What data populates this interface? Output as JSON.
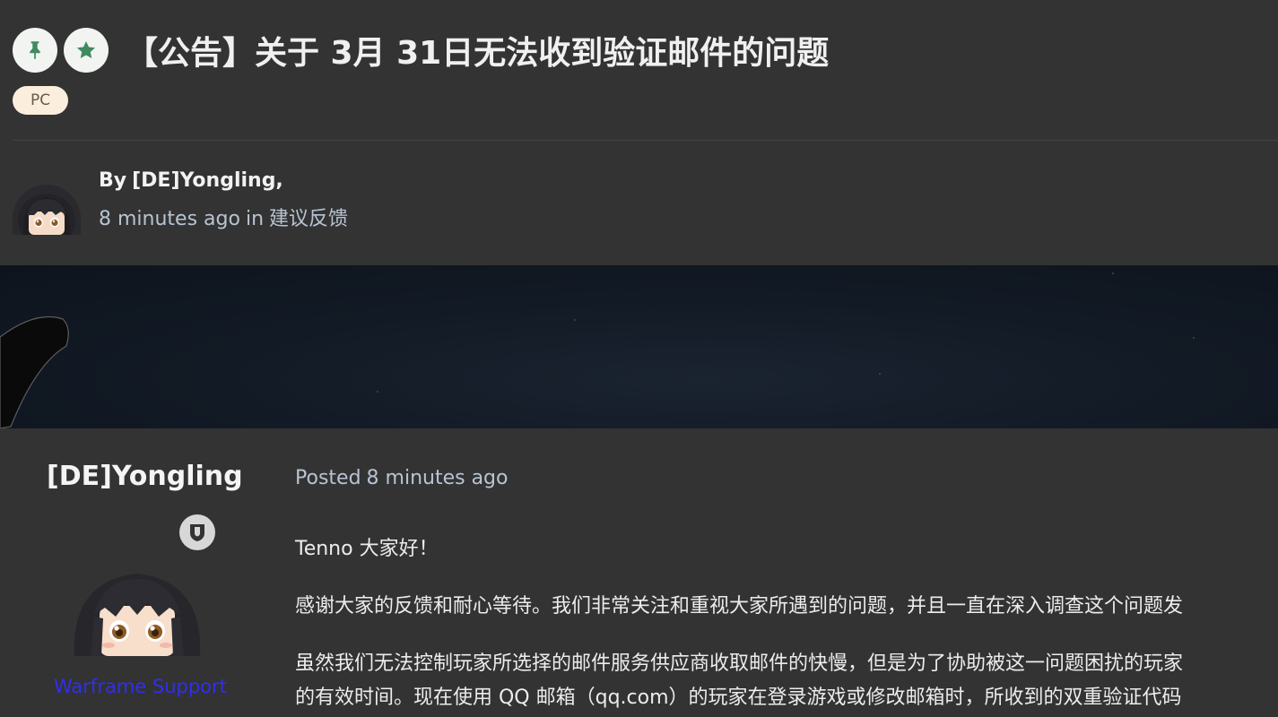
{
  "topic": {
    "title": "【公告】关于 3月 31日无法收到验证邮件的问题",
    "pinned_icon": "pin-icon",
    "featured_icon": "star-icon",
    "tag": "PC",
    "by_label": "By",
    "author": "[DE]Yongling,",
    "time_ago": "8 minutes ago",
    "in_label": "in",
    "category": "建议反馈"
  },
  "post": {
    "author_name": "[DE]Yongling",
    "rank_icon": "shield-icon",
    "group": "Warframe Support",
    "posted_label": "Posted",
    "posted_time": "8 minutes ago",
    "paragraphs": [
      "Tenno 大家好！",
      "感谢大家的反馈和耐心等待。我们非常关注和重视大家所遇到的问题，并且一直在深入调查这个问题发",
      "虽然我们无法控制玩家所选择的邮件服务供应商收取邮件的快慢，但是为了协助被这一问题困扰的玩家",
      "的有效时间。现在使用 QQ 邮箱（qq.com）的玩家在登录游戏或修改邮箱时，所收到的双重验证代码"
    ]
  },
  "colors": {
    "background": "#333333",
    "banner": "#121a25",
    "tag_bg": "#fbeedd",
    "meta_text": "#b8c4d2",
    "group_link": "#2f2ff0"
  }
}
